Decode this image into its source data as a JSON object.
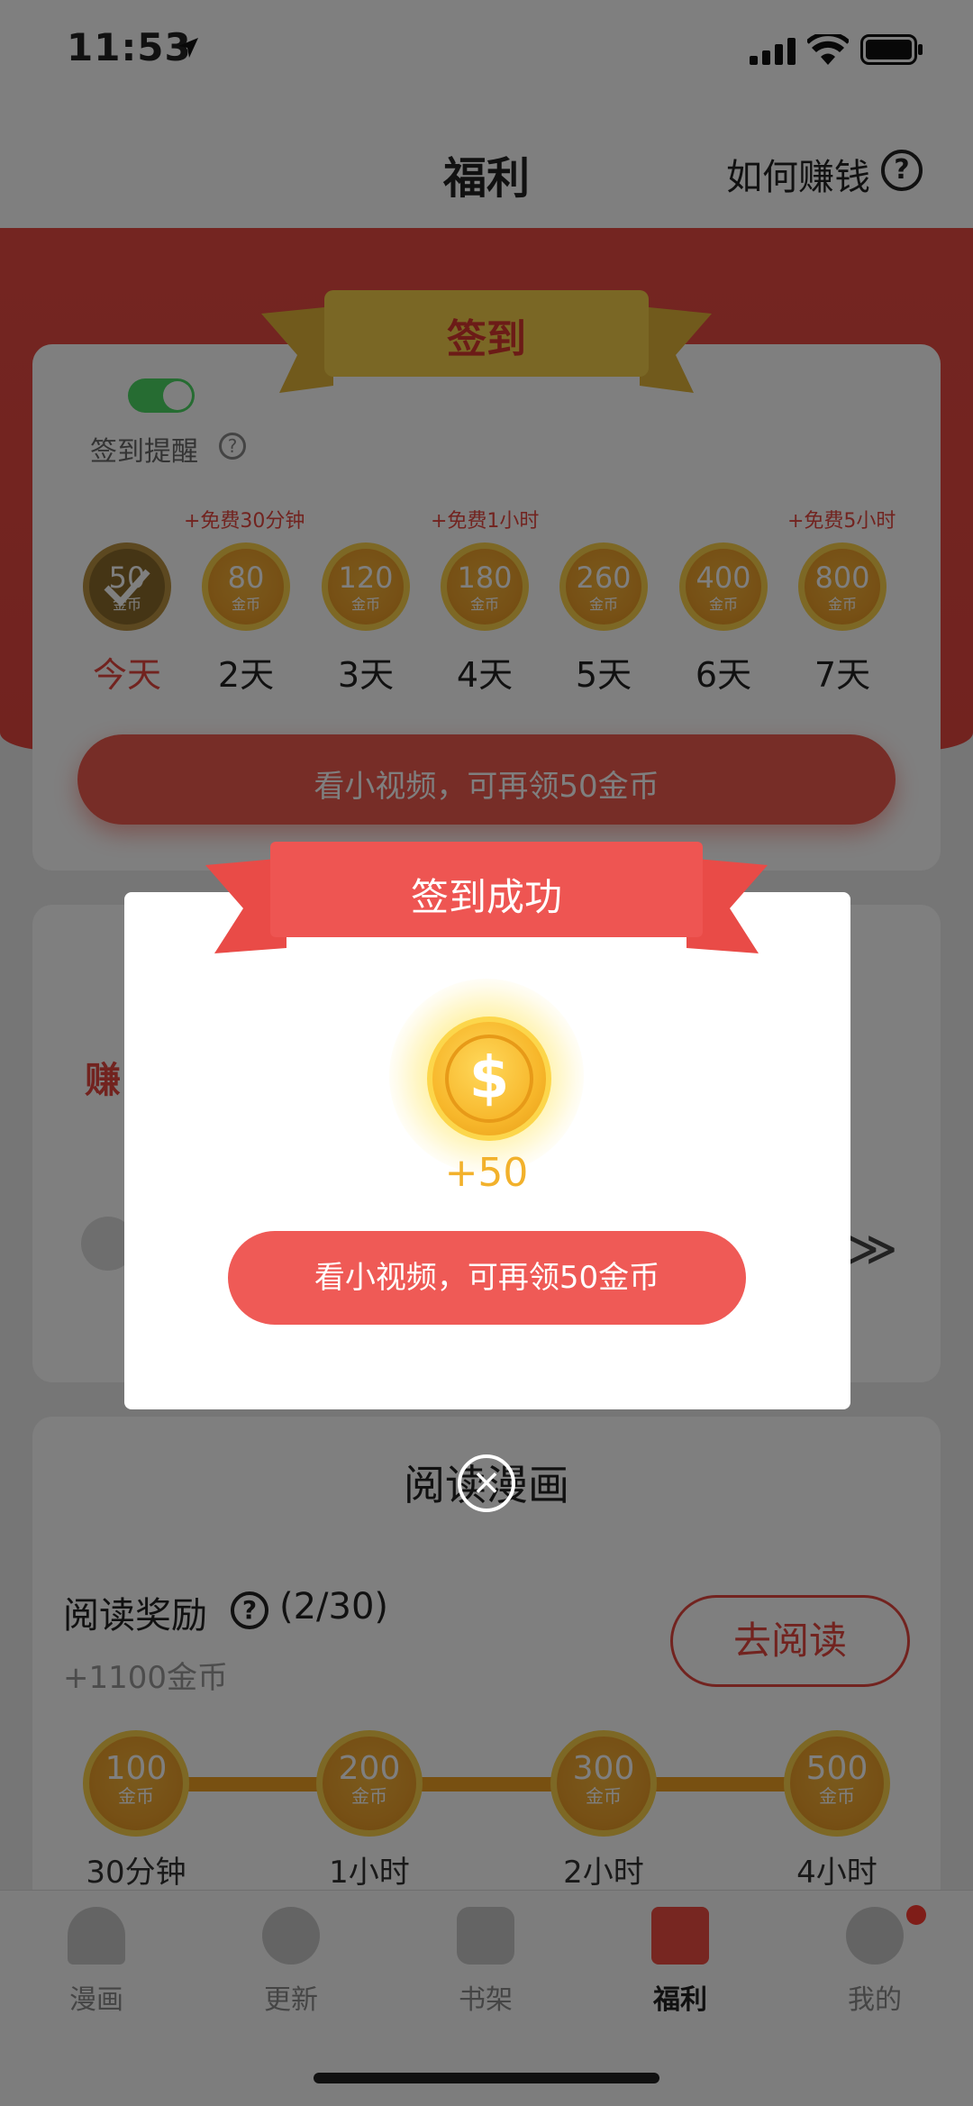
{
  "status_bar": {
    "time": "11:53"
  },
  "nav": {
    "title": "福利",
    "help_link": "如何赚钱",
    "help_icon": "?"
  },
  "checkin": {
    "ribbon_title": "签到",
    "remind_label": "签到提醒",
    "remind_on": true,
    "remind_help": "?",
    "bonuses": [
      "+免费30分钟",
      "+免费1小时",
      "+免费5小时"
    ],
    "coin_unit": "金币",
    "days": [
      {
        "coins": "50",
        "label": "今天"
      },
      {
        "coins": "80",
        "label": "2天"
      },
      {
        "coins": "120",
        "label": "3天"
      },
      {
        "coins": "180",
        "label": "4天"
      },
      {
        "coins": "260",
        "label": "5天"
      },
      {
        "coins": "400",
        "label": "6天"
      },
      {
        "coins": "800",
        "label": "7天"
      }
    ],
    "watch_button": "看小视频，可再领50金币"
  },
  "earn": {
    "label": "赚",
    "more": "≫"
  },
  "reading": {
    "title": "阅读漫画",
    "reward_label": "阅读奖励",
    "reward_help": "?",
    "progress": "(2/30)",
    "total": "+1100金币",
    "go_button": "去阅读",
    "milestones": [
      {
        "coins": "100",
        "label": "30分钟"
      },
      {
        "coins": "200",
        "label": "1小时"
      },
      {
        "coins": "300",
        "label": "2小时"
      },
      {
        "coins": "500",
        "label": "4小时"
      }
    ]
  },
  "tabs": [
    {
      "label": "漫画"
    },
    {
      "label": "更新"
    },
    {
      "label": "书架"
    },
    {
      "label": "福利"
    },
    {
      "label": "我的"
    }
  ],
  "dialog": {
    "title": "签到成功",
    "amount": "+50",
    "coin_symbol": "$",
    "watch_button": "看小视频，可再领50金币",
    "close_icon": "×"
  },
  "colors": {
    "brand_red": "#e4463f",
    "coin_gold": "#f2b12b"
  }
}
